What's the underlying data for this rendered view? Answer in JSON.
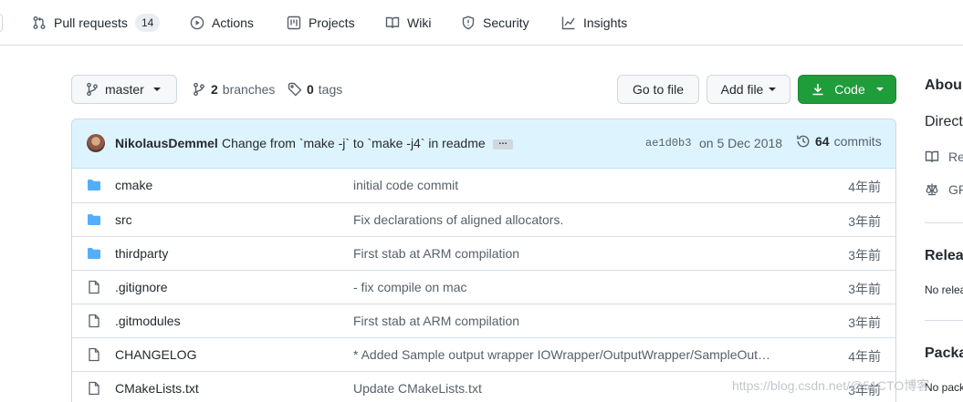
{
  "nav": {
    "tabs": [
      {
        "label": "Pull requests",
        "count": "14",
        "icon": "pull-request-icon"
      },
      {
        "label": "Actions",
        "icon": "play-icon"
      },
      {
        "label": "Projects",
        "icon": "project-icon"
      },
      {
        "label": "Wiki",
        "icon": "book-icon"
      },
      {
        "label": "Security",
        "icon": "shield-icon"
      },
      {
        "label": "Insights",
        "icon": "graph-icon"
      }
    ]
  },
  "toolbar": {
    "branch": "master",
    "branches_count": "2",
    "branches_label": "branches",
    "tags_count": "0",
    "tags_label": "tags",
    "go_to_file": "Go to file",
    "add_file": "Add file",
    "code": "Code"
  },
  "latest_commit": {
    "author": "NikolausDemmel",
    "message": "Change from `make -j` to `make -j4` in readme",
    "ellipsis": "…",
    "sha": "ae1d0b3",
    "date": "on 5 Dec 2018",
    "commits_count": "64",
    "commits_label": "commits"
  },
  "files": [
    {
      "type": "dir",
      "name": "cmake",
      "message": "initial code commit",
      "age": "4年前"
    },
    {
      "type": "dir",
      "name": "src",
      "message": "Fix declarations of aligned allocators.",
      "age": "3年前"
    },
    {
      "type": "dir",
      "name": "thirdparty",
      "message": "First stab at ARM compilation",
      "age": "3年前"
    },
    {
      "type": "file",
      "name": ".gitignore",
      "message": "- fix compile on mac",
      "age": "3年前"
    },
    {
      "type": "file",
      "name": ".gitmodules",
      "message": "First stab at ARM compilation",
      "age": "3年前"
    },
    {
      "type": "file",
      "name": "CHANGELOG",
      "message": "* Added Sample output wrapper IOWrapper/OutputWrapper/SampleOut…",
      "age": "4年前"
    },
    {
      "type": "file",
      "name": "CMakeLists.txt",
      "message": "Update CMakeLists.txt",
      "age": "3年前"
    }
  ],
  "sidebar": {
    "about_heading": "Abou",
    "description": "Direct",
    "readme_link": "Re",
    "license_link": "GP",
    "releases_heading": "Relea",
    "releases_text": "No relea",
    "packages_heading": "Packa",
    "packages_text": "No pack"
  },
  "watermark": "https://blog.csdn.net/@51CTO博客",
  "colors": {
    "code_button": "#1f9d3a",
    "commit_header_bg": "#ddf4ff",
    "folder_icon": "#54aeff",
    "muted_text": "#57606a"
  }
}
